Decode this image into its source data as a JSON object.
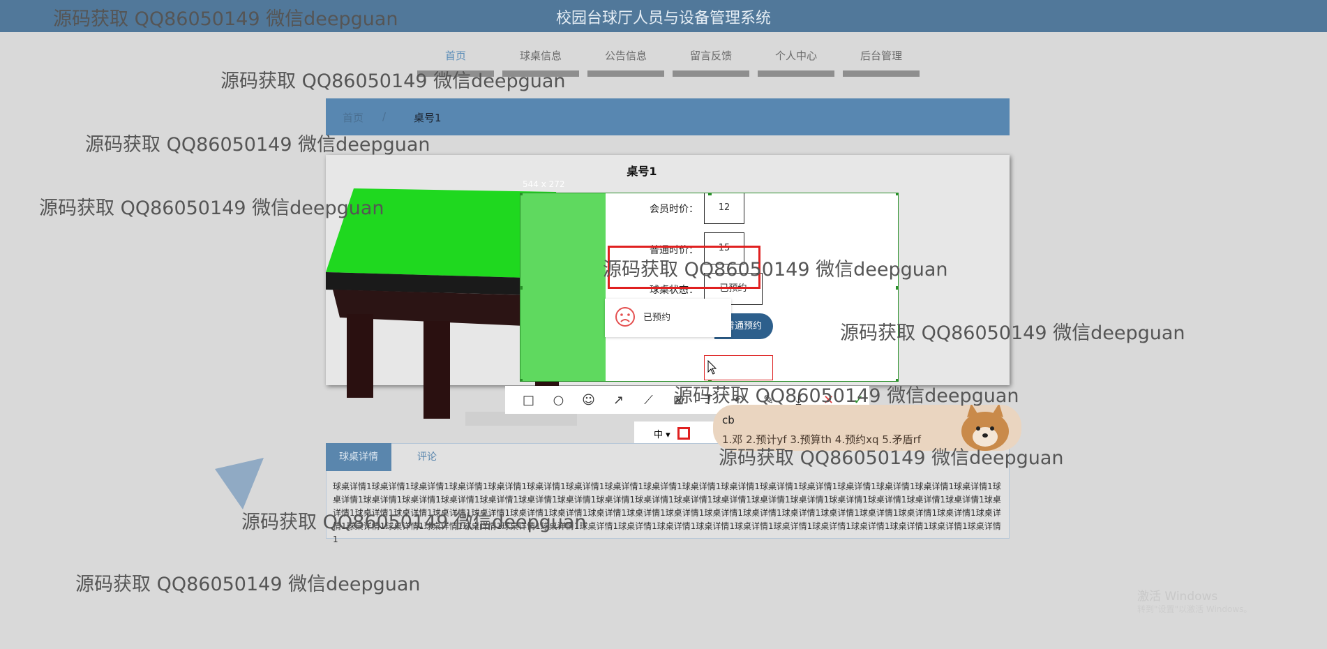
{
  "header": {
    "title": "校园台球厅人员与设备管理系统"
  },
  "nav": {
    "items": [
      {
        "label": "首页"
      },
      {
        "label": "球桌信息"
      },
      {
        "label": "公告信息"
      },
      {
        "label": "留言反馈"
      },
      {
        "label": "个人中心"
      },
      {
        "label": "后台管理"
      }
    ]
  },
  "breadcrumb": {
    "home": "首页",
    "separator": "/",
    "current": "桌号1"
  },
  "product": {
    "title": "桌号1",
    "member_price_label": "会员时价：",
    "member_price_value": "12",
    "normal_price_label": "普通时价：",
    "normal_price_value": "15",
    "status_label": "球桌状态：",
    "status_value": "已预约",
    "book_button": "普通预约"
  },
  "toast": {
    "message": "已预约"
  },
  "screenshot_tool": {
    "size_label": "544 x 272",
    "font_size_option": "中 ▾"
  },
  "tabs": [
    {
      "label": "球桌详情"
    },
    {
      "label": "评论"
    }
  ],
  "details": {
    "text": "球桌详情1球桌详情1球桌详情1球桌详情1球桌详情1球桌详情1球桌详情1球桌详情1球桌详情1球桌详情1球桌详情1球桌详情1球桌详情1球桌详情1球桌详情1球桌详情1球桌详情1球桌详情1球桌详情1球桌详情1球桌详情1球桌详情1球桌详情1球桌详情1球桌详情1球桌详情1球桌详情1球桌详情1球桌详情1球桌详情1球桌详情1球桌详情1球桌详情1球桌详情1球桌详情1球桌详情1球桌详情1球桌详情1球桌详情1球桌详情1球桌详情1球桌详情1球桌详情1球桌详情1球桌详情1球桌详情1球桌详情1球桌详情1球桌详情1球桌详情1球桌详情1球桌详情1球桌详情1球桌详情1球桌详情1球桌详情1球桌详情1球桌详情1球桌详情1球桌详情1球桌详情1球桌详情1球桌详情1球桌详情1球桌详情1球桌详情1球桌详情1球桌详情1球桌详情1"
  },
  "ime": {
    "input": "cb",
    "candidates": "1.邓  2.预计yf  3.预算th  4.预约xq  5.矛盾rf"
  },
  "watermark": {
    "text": "源码获取 QQ86050149 微信deepguan"
  },
  "windows_activation": {
    "title": "激活 Windows",
    "subtitle": "转到\"设置\"以激活 Windows。"
  },
  "colors": {
    "header": "#51789a",
    "accent": "#5887b1",
    "selection": "#2a8f2a",
    "annotation_red": "#e02020"
  }
}
